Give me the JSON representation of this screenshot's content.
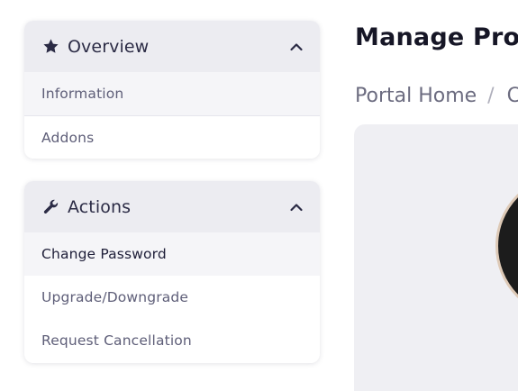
{
  "sidebar": {
    "overview": {
      "title": "Overview",
      "icon": "star-icon",
      "toggle_icon": "chevron-up-icon",
      "items": [
        {
          "label": "Information"
        },
        {
          "label": "Addons"
        }
      ]
    },
    "actions": {
      "title": "Actions",
      "icon": "wrench-icon",
      "toggle_icon": "chevron-up-icon",
      "items": [
        {
          "label": "Change Password",
          "active": true
        },
        {
          "label": "Upgrade/Downgrade"
        },
        {
          "label": "Request Cancellation"
        }
      ]
    }
  },
  "main": {
    "page_title": "Manage Prod",
    "breadcrumb": {
      "home": "Portal Home",
      "separator": "/",
      "current": "C"
    }
  },
  "colors": {
    "panel_header_bg": "#ececf1",
    "item_highlight_bg": "#f5f5f8",
    "text_dark": "#2b2b45",
    "text_muted": "#5e5e78",
    "card_bg": "#efeff3"
  }
}
